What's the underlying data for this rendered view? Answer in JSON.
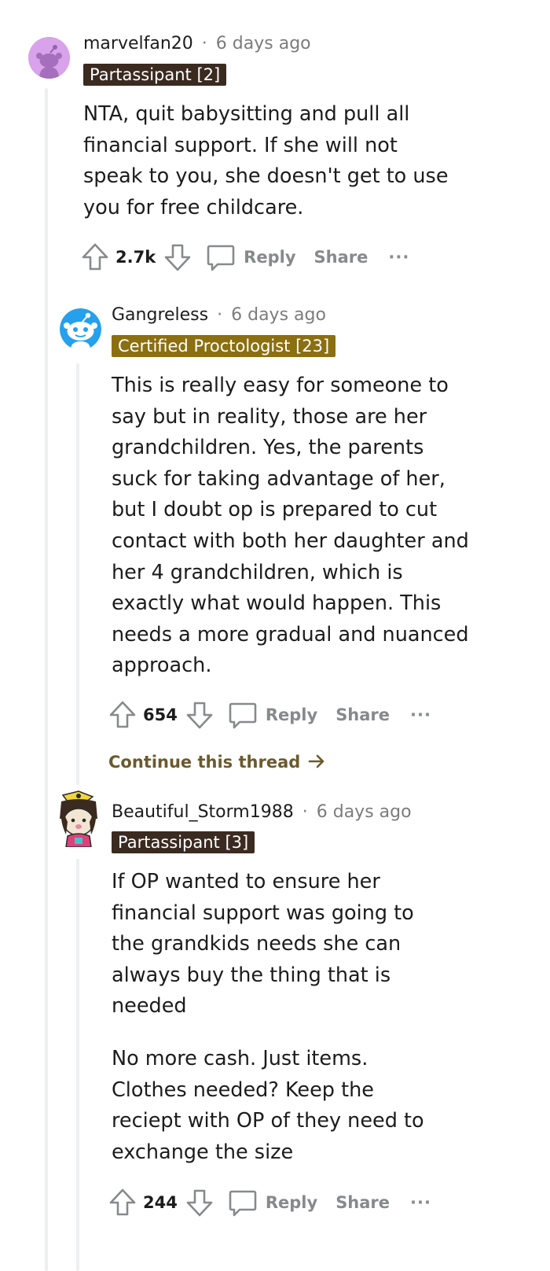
{
  "comments": [
    {
      "username": "marvelfan20",
      "separator": "·",
      "time": "6 days ago",
      "flair": "Partassipant [2]",
      "flair_color": "#3a2a20",
      "paragraphs": [
        "NTA, quit babysitting and pull all financial support. If she will not speak to you, she doesn't get to use you for free childcare."
      ],
      "score": "2.7k",
      "reply_label": "Reply",
      "share_label": "Share",
      "more_label": "···"
    },
    {
      "username": "Gangreless",
      "separator": "·",
      "time": "6 days ago",
      "flair": "Certified Proctologist [23]",
      "flair_color": "#8b6f10",
      "paragraphs": [
        "This is really easy for someone to say but in reality, those are her grandchildren. Yes, the parents suck for taking advantage of her, but I doubt op is prepared to cut contact with both her daughter and her 4 grandchildren, which is exactly what would happen. This needs a more gradual and nuanced approach."
      ],
      "score": "654",
      "reply_label": "Reply",
      "share_label": "Share",
      "more_label": "···",
      "continue_label": "Continue this thread"
    },
    {
      "username": "Beautiful_Storm1988",
      "separator": "·",
      "time": "6 days ago",
      "flair": "Partassipant [3]",
      "flair_color": "#3a2a20",
      "paragraphs": [
        "If OP wanted to ensure her financial support was going to the grandkids needs she can always buy the thing that is needed",
        "No more cash. Just items. Clothes needed? Keep the reciept with OP of they need to exchange the size"
      ],
      "score": "244",
      "reply_label": "Reply",
      "share_label": "Share",
      "more_label": "···"
    }
  ]
}
